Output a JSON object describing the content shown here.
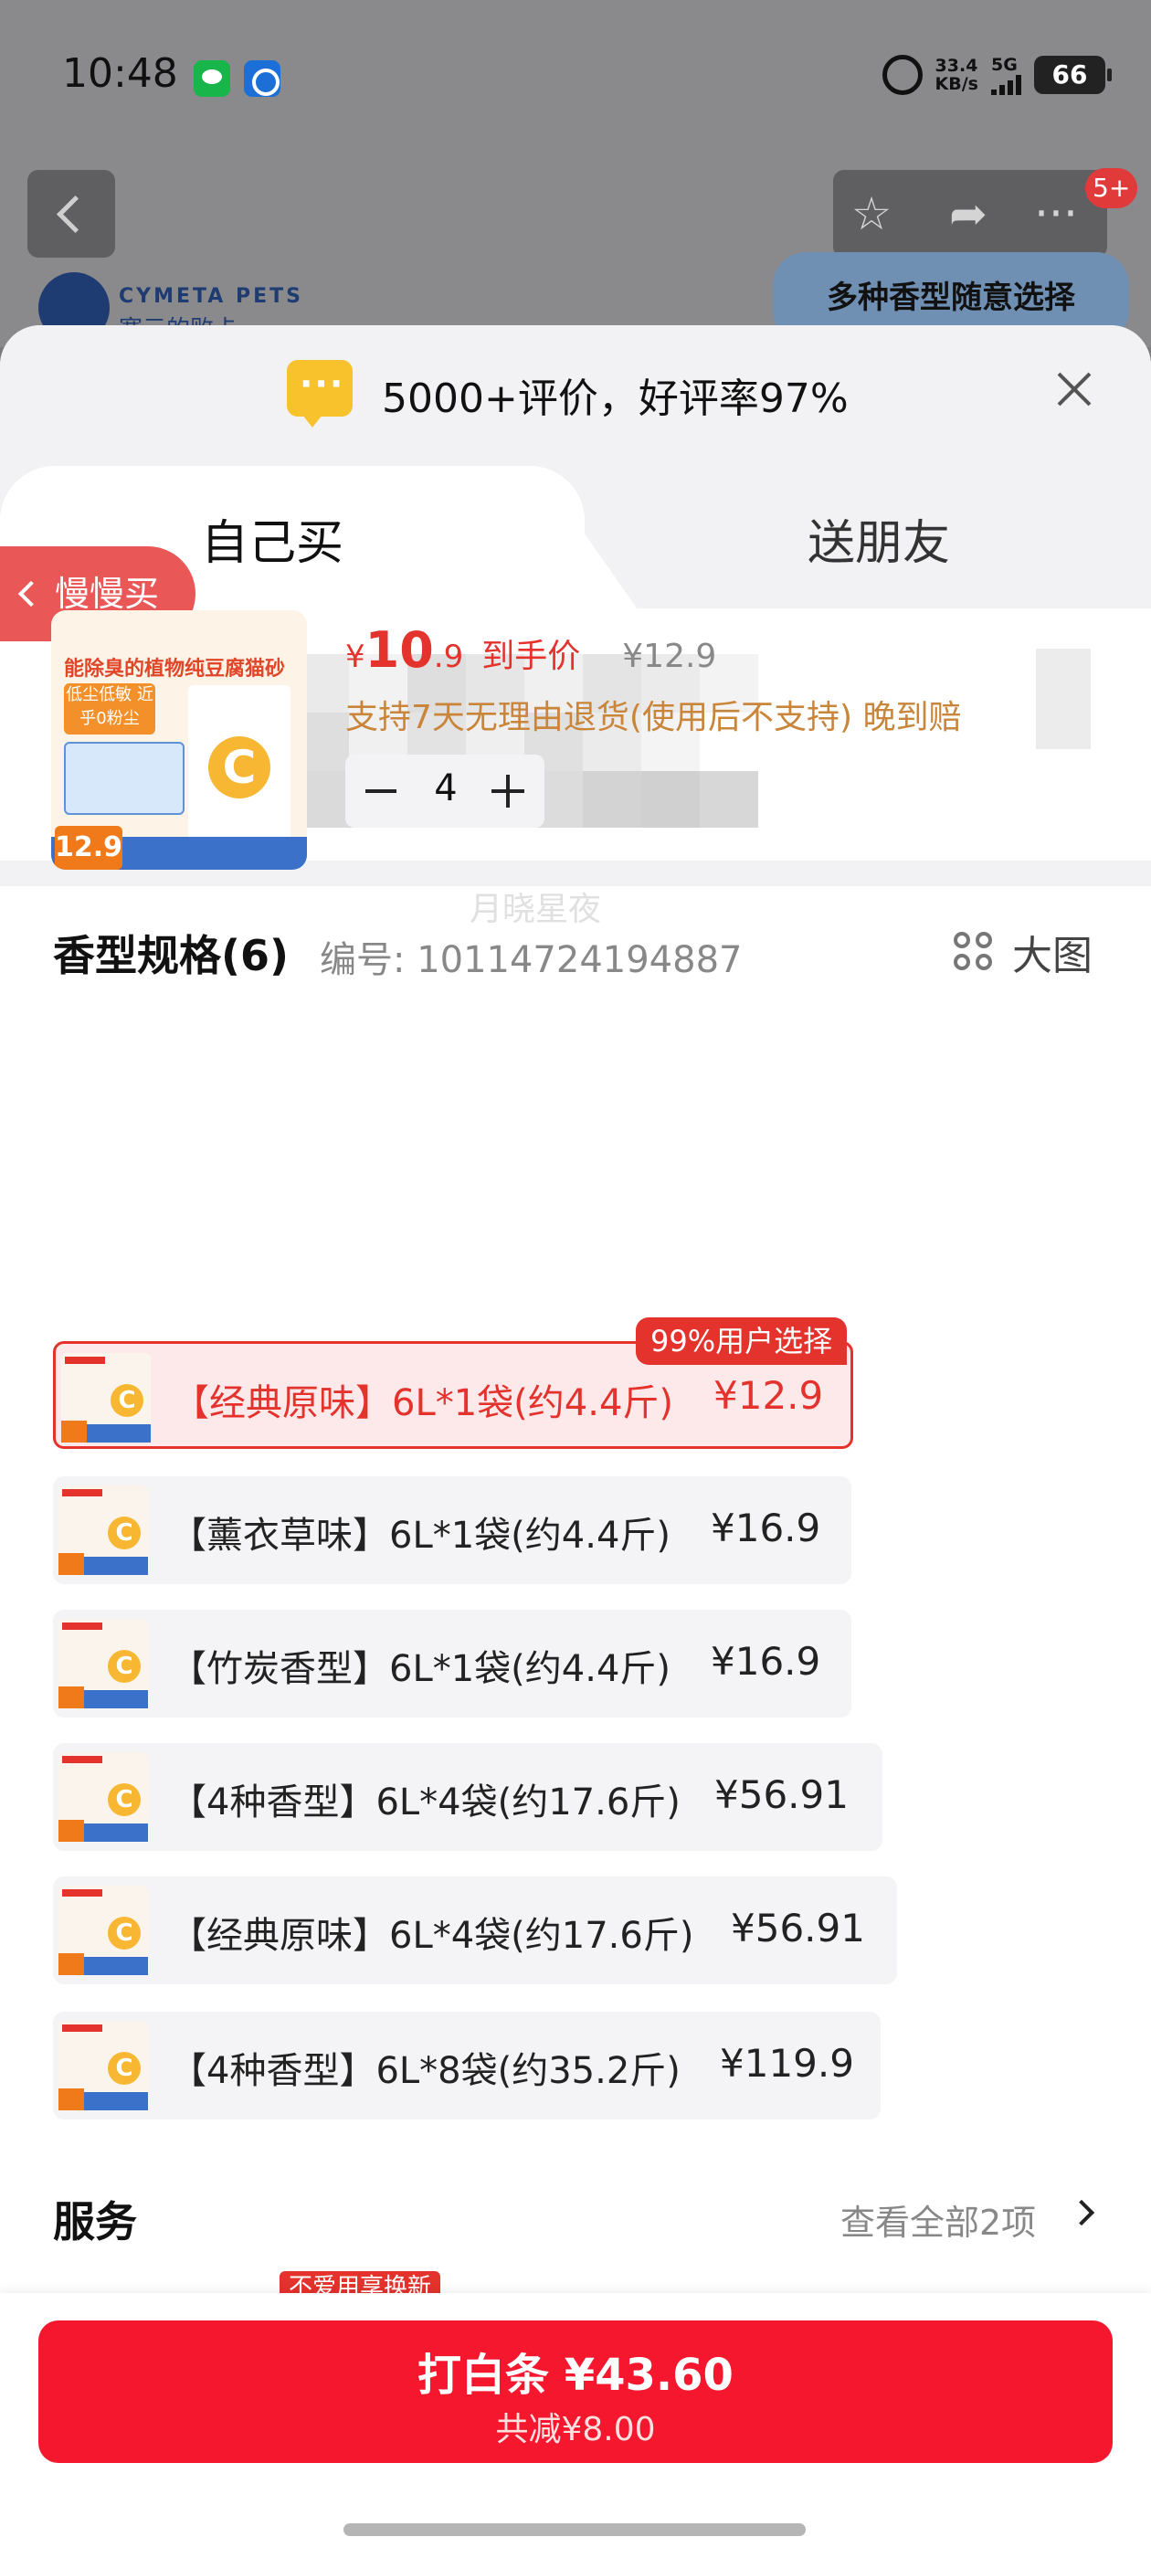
{
  "status_bar": {
    "time": "10:48",
    "net_speed_value": "33.4",
    "net_speed_unit": "KB/s",
    "network": "5G",
    "battery": "66"
  },
  "background": {
    "cart_badge": "5+",
    "brand_name_en": "CYMETA PETS",
    "brand_name_cn": "塞元的败卡",
    "promo": "多种香型随意选择"
  },
  "sheet": {
    "review_summary": "5000+评价，好评率97%",
    "tabs": {
      "self": "自己买",
      "friend": "送朋友"
    },
    "slow_buy": "慢慢买"
  },
  "product": {
    "image_title": "能除臭的植物纯豆腐猫砂",
    "image_tag": "低尘低敏 近乎0粉尘",
    "image_price": "12.9",
    "currency": "¥",
    "price_int": "10",
    "price_dec": ".9",
    "price_label": "到手价",
    "original_price": "¥12.9",
    "return_policy": "支持7天无理由退货(使用后不支持) 晚到赔",
    "quantity": "4",
    "watermark": "月晓星夜"
  },
  "spec": {
    "title": "香型规格(6)",
    "code": "编号: 10114724194887",
    "big_view": "大图",
    "pick_badge": "99%用户选择",
    "items": [
      {
        "name": "【经典原味】6L*1袋(约4.4斤)",
        "price": "¥12.9",
        "selected": true
      },
      {
        "name": "【薰衣草味】6L*1袋(约4.4斤)",
        "price": "¥16.9",
        "selected": false
      },
      {
        "name": "【竹炭香型】6L*1袋(约4.4斤)",
        "price": "¥16.9",
        "selected": false
      },
      {
        "name": "【4种香型】6L*4袋(约17.6斤)",
        "price": "¥56.91",
        "selected": false
      },
      {
        "name": "【经典原味】6L*4袋(约17.6斤)",
        "price": "¥56.91",
        "selected": false
      },
      {
        "name": "【4种香型】6L*8袋(约35.2斤)",
        "price": "¥119.9",
        "selected": false
      }
    ]
  },
  "service": {
    "title": "服务",
    "view_all": "查看全部2项",
    "tag": "不爱用享换新"
  },
  "checkout": {
    "main": "打白条 ¥43.60",
    "sub": "共减¥8.00"
  },
  "colors": {
    "accent": "#e4322c",
    "pay_button": "#f5172d",
    "policy_text": "#c9853a"
  }
}
